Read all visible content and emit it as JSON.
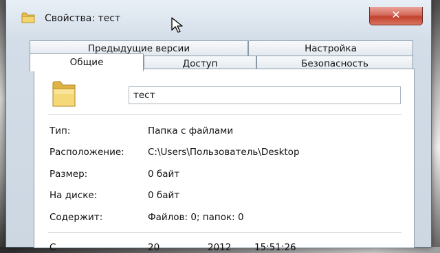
{
  "window": {
    "title": "Свойства: тест",
    "close_symbol": "✕"
  },
  "tabs": {
    "row1": [
      "Предыдущие версии",
      "Настройка"
    ],
    "row2": [
      "Общие",
      "Доступ",
      "Безопасность"
    ],
    "active": "Общие"
  },
  "general": {
    "name_value": "тест",
    "properties": [
      {
        "label": "Тип:",
        "value": "Папка с файлами"
      },
      {
        "label": "Расположение:",
        "value": "C:\\Users\\Пользователь\\Desktop"
      },
      {
        "label": "Размер:",
        "value": "0 байт"
      },
      {
        "label": "На диске:",
        "value": "0 байт"
      },
      {
        "label": "Содержит:",
        "value": "Файлов: 0; папок: 0"
      }
    ],
    "partial_row": {
      "label": "С",
      "value_a": "20",
      "value_b": "2012",
      "value_c": "15:51:26"
    }
  },
  "icons": {
    "title_icon": "folder-icon",
    "large_icon": "folder-icon",
    "cursor": "mouse-cursor-icon"
  },
  "colors": {
    "close_button": "#c2412d",
    "folder": "#e8c04f",
    "titlebar": "#dce6f0"
  }
}
